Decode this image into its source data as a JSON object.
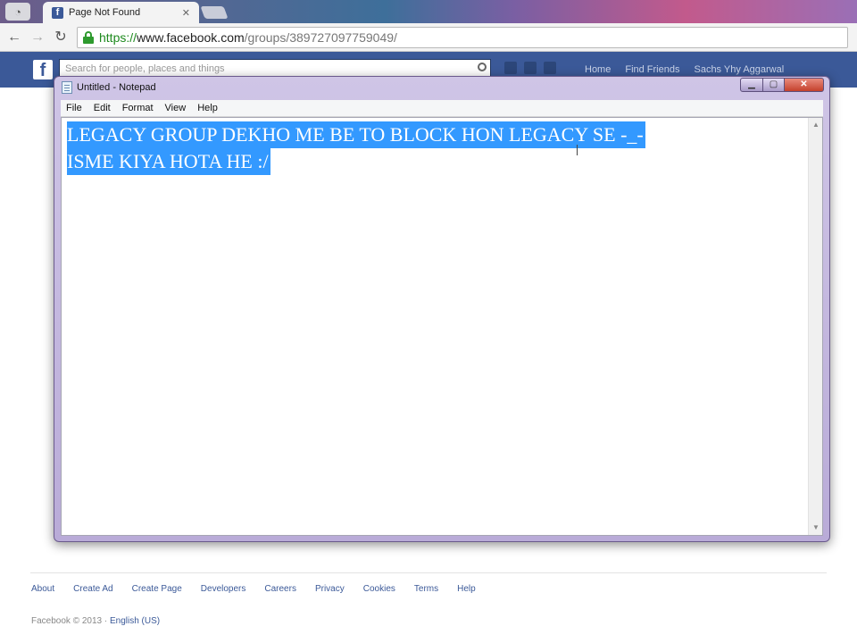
{
  "browser": {
    "tab_title": "Page Not Found",
    "tab_close": "✕",
    "url_scheme": "https://",
    "url_host": "www.facebook.com",
    "url_path": "/groups/389727097759049/"
  },
  "facebook": {
    "logo": "f",
    "search_placeholder": "Search for people, places and things",
    "nav": [
      "Home",
      "Find Friends",
      "Sachs Yhy Aggarwal"
    ],
    "footer_links": [
      "About",
      "Create Ad",
      "Create Page",
      "Developers",
      "Careers",
      "Privacy",
      "Cookies",
      "Terms",
      "Help"
    ],
    "copyright": "Facebook © 2013 ·",
    "language": "English (US)"
  },
  "notepad": {
    "title": "Untitled - Notepad",
    "menu": [
      "File",
      "Edit",
      "Format",
      "View",
      "Help"
    ],
    "lines": [
      "LEGACY GROUP DEKHO ME BE TO BLOCK HON LEGACY SE -_-",
      "ISME KIYA HOTA HE :/"
    ],
    "selection_color": "#3399ff"
  },
  "colors": {
    "facebook_blue": "#3b5998",
    "secure_green": "#1e8a1e"
  }
}
